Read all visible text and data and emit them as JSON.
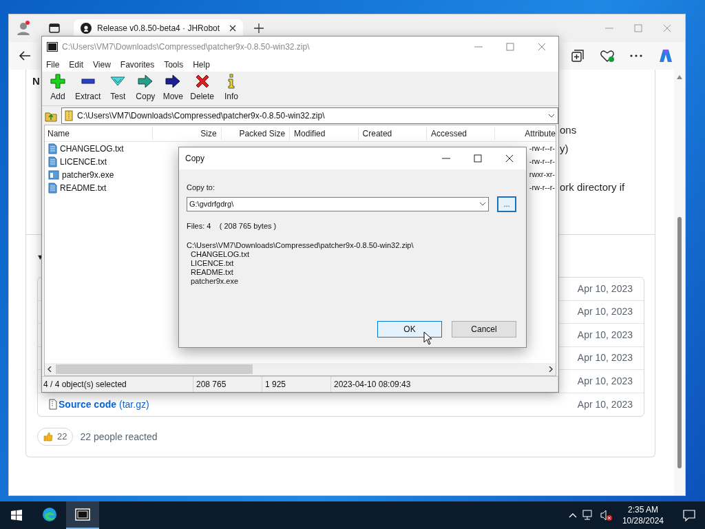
{
  "browser": {
    "tab_title": "Release v0.8.50-beta4 · JHRobot",
    "page": {
      "heading_fragment": "N",
      "text_fragments": [
        "ons",
        "y)",
        "ork directory if"
      ],
      "section_toggle": "▼",
      "assets": [
        {
          "date": "Apr 10, 2023"
        },
        {
          "date": "Apr 10, 2023"
        },
        {
          "date": "Apr 10, 2023"
        },
        {
          "date": "Apr 10, 2023"
        },
        {
          "date": "Apr 10, 2023"
        },
        {
          "name": "Source code",
          "suffix": "(tar.gz)",
          "date": "Apr 10, 2023"
        }
      ],
      "reaction": {
        "count": "22",
        "text": "22 people reacted"
      }
    }
  },
  "archive_window": {
    "title": "C:\\Users\\VM7\\Downloads\\Compressed\\patcher9x-0.8.50-win32.zip\\",
    "menu": [
      "File",
      "Edit",
      "View",
      "Favorites",
      "Tools",
      "Help"
    ],
    "toolbar": [
      {
        "label": "Add",
        "kind": "add"
      },
      {
        "label": "Extract",
        "kind": "extract"
      },
      {
        "label": "Test",
        "kind": "test"
      },
      {
        "label": "Copy",
        "kind": "copy"
      },
      {
        "label": "Move",
        "kind": "move"
      },
      {
        "label": "Delete",
        "kind": "delete"
      },
      {
        "label": "Info",
        "kind": "info"
      }
    ],
    "address": "C:\\Users\\VM7\\Downloads\\Compressed\\patcher9x-0.8.50-win32.zip\\",
    "columns": [
      "Name",
      "Size",
      "Packed Size",
      "Modified",
      "Created",
      "Accessed",
      "Attribute"
    ],
    "files": [
      {
        "name": "CHANGELOG.txt",
        "kind": "text",
        "attributes": "-rw-r--r-"
      },
      {
        "name": "LICENCE.txt",
        "kind": "text",
        "attributes": "-rw-r--r-"
      },
      {
        "name": "patcher9x.exe",
        "kind": "program",
        "attributes": "rwxr-xr-"
      },
      {
        "name": "README.txt",
        "kind": "text",
        "attributes": "-rw-r--r-"
      }
    ],
    "status": [
      "4 / 4 object(s) selected",
      "208 765",
      "1 925",
      "2023-04-10 08:09:43"
    ]
  },
  "copy_dialog": {
    "title": "Copy",
    "destination_label": "Copy to:",
    "destination": "G:\\gvdrfgdrg\\",
    "browse": "...",
    "summary": "Files: 4    ( 208 765 bytes )",
    "source_path": "C:\\Users\\VM7\\Downloads\\Compressed\\patcher9x-0.8.50-win32.zip\\",
    "files": [
      "CHANGELOG.txt",
      "LICENCE.txt",
      "README.txt",
      "patcher9x.exe"
    ],
    "buttons": [
      {
        "label": "OK",
        "default": true
      },
      {
        "label": "Cancel",
        "default": false
      }
    ]
  },
  "taskbar": {
    "apps": [
      {
        "kind": "edge",
        "active": false
      },
      {
        "kind": "archiver",
        "active": true
      }
    ],
    "time": "2:35 AM",
    "date": "10/28/2024"
  }
}
